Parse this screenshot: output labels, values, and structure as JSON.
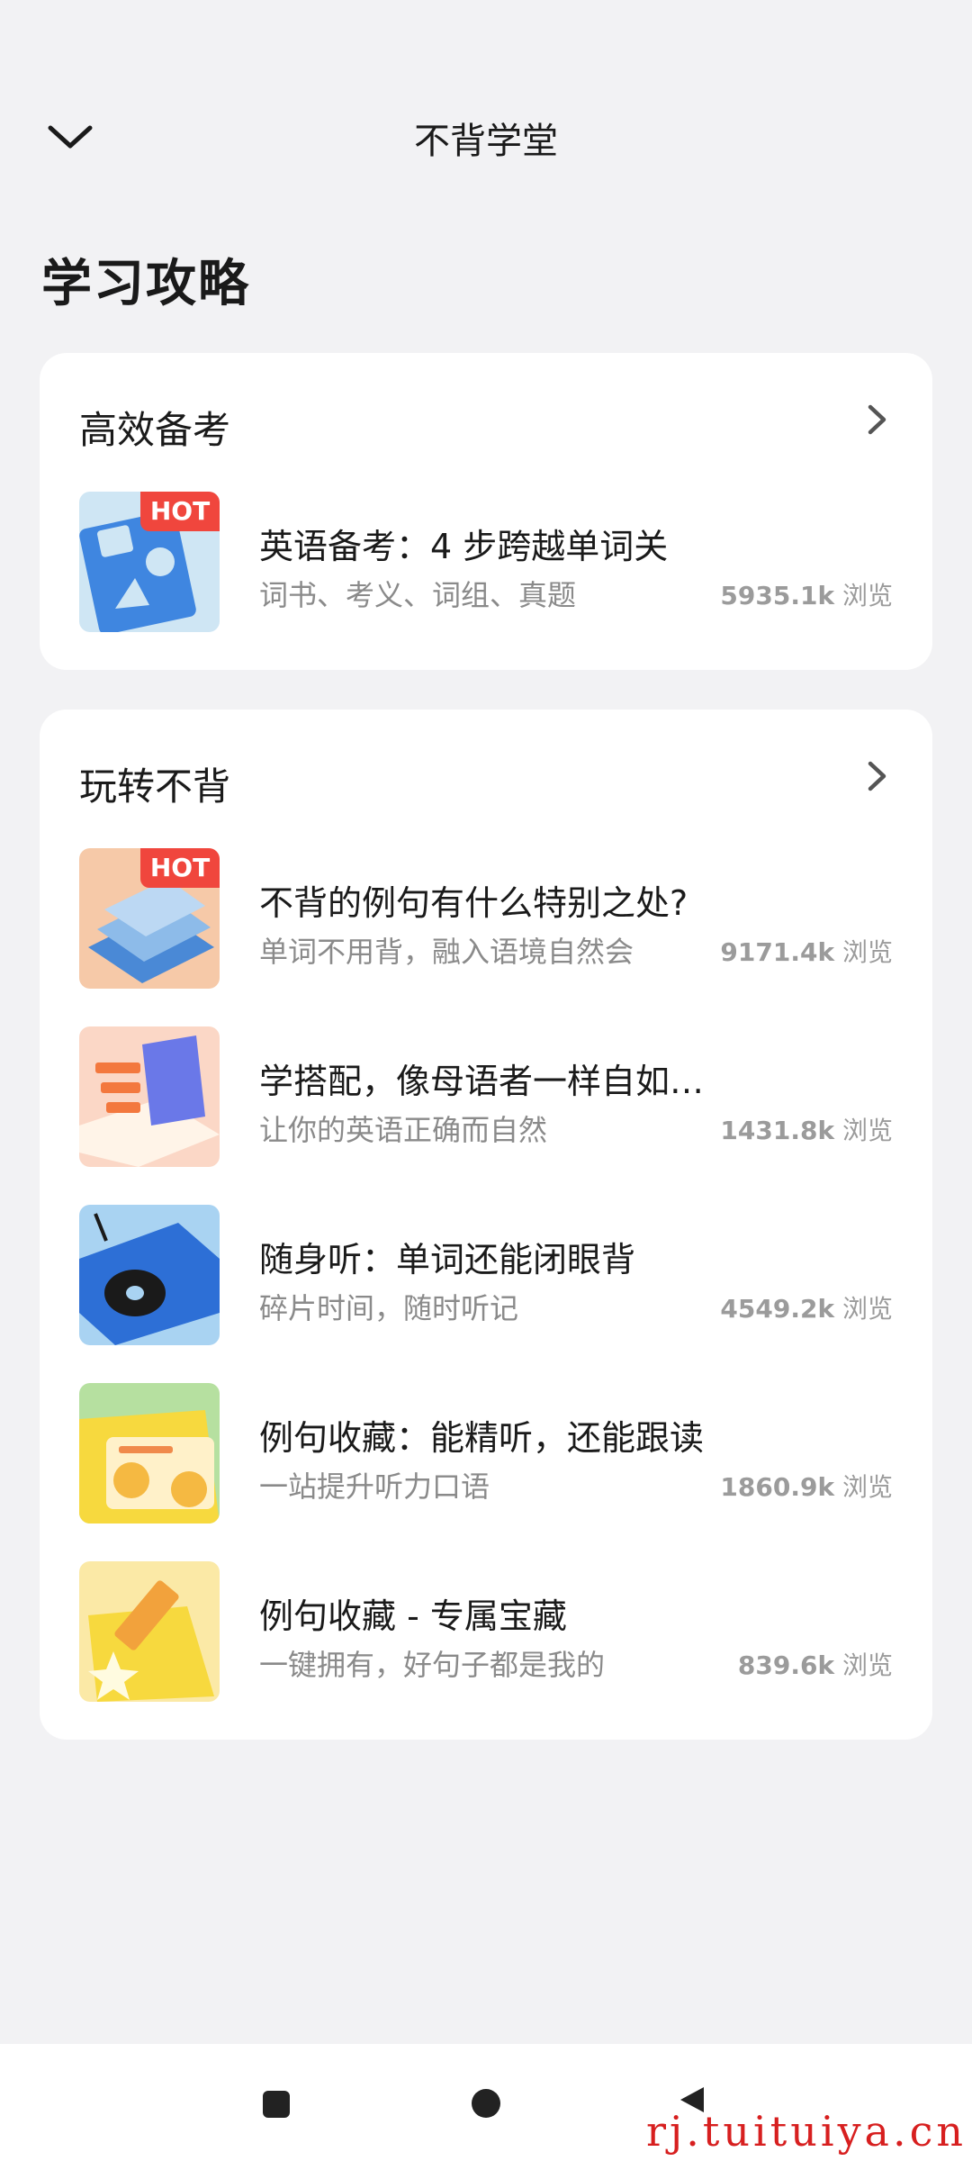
{
  "header": {
    "title": "不背学堂"
  },
  "page_title": "学习攻略",
  "sections": [
    {
      "title": "高效备考",
      "items": [
        {
          "title": "英语备考：4 步跨越单词关",
          "subtitle": "词书、考义、词组、真题",
          "views": "5935.1k",
          "hot": "HOT"
        }
      ]
    },
    {
      "title": "玩转不背",
      "items": [
        {
          "title": "不背的例句有什么特别之处?",
          "subtitle": "单词不用背，融入语境自然会",
          "views": "9171.4k",
          "hot": "HOT"
        },
        {
          "title": "学搭配，像母语者一样自如…",
          "subtitle": "让你的英语正确而自然",
          "views": "1431.8k"
        },
        {
          "title": "随身听：单词还能闭眼背",
          "subtitle": "碎片时间，随时听记",
          "views": "4549.2k"
        },
        {
          "title": "例句收藏：能精听，还能跟读",
          "subtitle": "一站提升听力口语",
          "views": "1860.9k"
        },
        {
          "title": "例句收藏 - 专属宝藏",
          "subtitle": "一键拥有，好句子都是我的",
          "views": "839.6k"
        }
      ]
    }
  ],
  "views_unit": "浏览",
  "watermark": "rj.tuituiya.cn"
}
